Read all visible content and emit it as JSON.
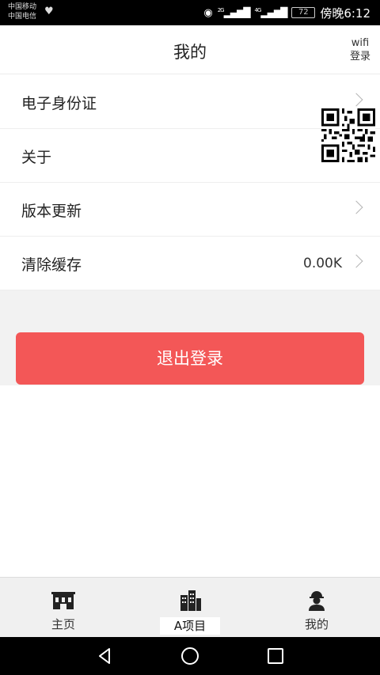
{
  "status_bar": {
    "carrier_1": "中国移动",
    "carrier_2": "中国电信",
    "net_2g": "2G",
    "net_4g": "4G",
    "battery": "72",
    "time": "傍晚6:12"
  },
  "header": {
    "title": "我的",
    "wifi_line1": "wifi",
    "wifi_line2": "登录"
  },
  "menu": [
    {
      "label": "电子身份证",
      "value": ""
    },
    {
      "label": "关于",
      "value": ""
    },
    {
      "label": "版本更新",
      "value": ""
    },
    {
      "label": "清除缓存",
      "value": "0.00K"
    }
  ],
  "logout_label": "退出登录",
  "tabs": [
    {
      "label": "主页",
      "icon": "building-icon"
    },
    {
      "label": "A项目",
      "icon": "city-icon"
    },
    {
      "label": "我的",
      "icon": "worker-icon"
    }
  ],
  "colors": {
    "accent": "#f35757",
    "background_gray": "#f2f2f2",
    "tabbar": "#f0f0f0"
  }
}
